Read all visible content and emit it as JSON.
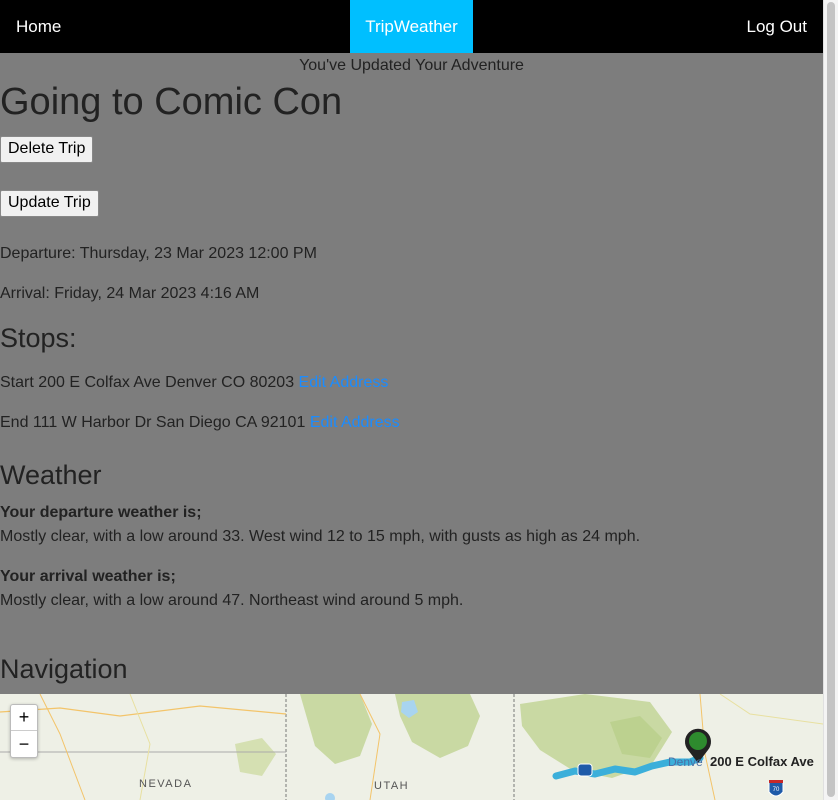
{
  "nav": {
    "home": "Home",
    "brand": "TripWeather",
    "logout": "Log Out"
  },
  "flash": "You've Updated Your Adventure",
  "trip": {
    "title": "Going to Comic Con",
    "delete_label": "Delete Trip",
    "update_label": "Update Trip",
    "departure": "Departure: Thursday, 23 Mar 2023 12:00 PM",
    "arrival": "Arrival: Friday, 24 Mar 2023 4:16 AM"
  },
  "stops": {
    "heading": "Stops:",
    "items": [
      {
        "text": "Start 200 E Colfax Ave Denver CO 80203",
        "link": "Edit Address"
      },
      {
        "text": "End 111 W Harbor Dr San Diego CA 92101",
        "link": "Edit Address"
      }
    ]
  },
  "weather": {
    "heading": "Weather",
    "departure_label": "Your departure weather is;",
    "departure_text": "Mostly clear, with a low around 33. West wind 12 to 15 mph, with gusts as high as 24 mph.",
    "arrival_label": "Your arrival weather is;",
    "arrival_text": "Mostly clear, with a low around 47. Northeast wind around 5 mph."
  },
  "navigation": {
    "heading": "Navigation",
    "zoom_in": "+",
    "zoom_out": "−",
    "state_labels": [
      "NEVADA",
      "UTAH"
    ],
    "city_label": "Denve",
    "marker_label": "200 E Colfax Ave",
    "highway_shields": [
      "70"
    ],
    "colors": {
      "route": "#3bafda",
      "marker": "#2e8b2e",
      "land_green": "#c9d9a3",
      "brand": "#00bfff",
      "link": "#1a8cff"
    }
  }
}
